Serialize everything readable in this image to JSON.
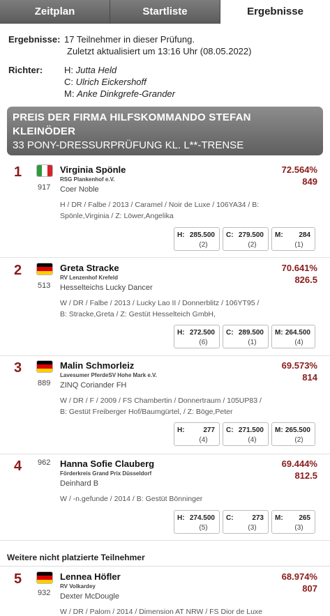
{
  "tabs": [
    {
      "label": "Zeitplan"
    },
    {
      "label": "Startliste"
    },
    {
      "label": "Ergebnisse"
    }
  ],
  "info": {
    "results_label": "Ergebnisse:",
    "results_line1": "17 Teilnehmer in dieser Prüfung.",
    "results_line2": "Zuletzt aktualisiert um 13:16 Uhr (08.05.2022)",
    "judges_label": "Richter:",
    "judges": [
      {
        "pos": "H:",
        "name": "Jutta Held"
      },
      {
        "pos": "C:",
        "name": "Ulrich Eickershoff"
      },
      {
        "pos": "M:",
        "name": "Anke Dinkgrefe-Grander"
      }
    ]
  },
  "competition": {
    "title_line1": "PREIS DER FIRMA HILFSKOMMANDO STEFAN",
    "title_line2": "KLEINÖDER",
    "subtitle": "33 PONY-DRESSURPRÜFUNG KL. L**-TRENSE"
  },
  "colors": {
    "accent": "#8b1a1a",
    "banner": "#6e6e6e"
  },
  "results": [
    {
      "rank": "1",
      "flag": "italy-flag",
      "bib": "917",
      "rider": "Virginia Spönle",
      "club": "RSG Plankenhof e.V.",
      "horse": "Coer Noble",
      "details_line1": "H / DR / Falbe / 2013 / Caramel / Noir de Luxe / 106YA34 / B:",
      "details_line2": "Spönle,Virginia / Z: Löwer,Angelika",
      "percent": "72.564%",
      "points": "849",
      "scores": [
        {
          "judge": "H:",
          "score": "285.500",
          "rank": "(2)"
        },
        {
          "judge": "C:",
          "score": "279.500",
          "rank": "(2)"
        },
        {
          "judge": "M:",
          "score": "284",
          "rank": "(1)"
        }
      ]
    },
    {
      "rank": "2",
      "flag": "germany-flag",
      "bib": "513",
      "rider": "Greta Stracke",
      "club": "RV Lenzenhof Krefeld",
      "horse": "Hesselteichs Lucky Dancer",
      "details_line1": "W / DR / Falbe / 2013 / Lucky Lao II / Donnerblitz / 106YT95 /",
      "details_line2": "B: Stracke,Greta / Z: Gestüt Hesselteich GmbH,",
      "percent": "70.641%",
      "points": "826.5",
      "scores": [
        {
          "judge": "H:",
          "score": "272.500",
          "rank": "(6)"
        },
        {
          "judge": "C:",
          "score": "289.500",
          "rank": "(1)"
        },
        {
          "judge": "M:",
          "score": "264.500",
          "rank": "(4)"
        }
      ]
    },
    {
      "rank": "3",
      "flag": "germany-flag",
      "bib": "889",
      "rider": "Malin Schmorleiz",
      "club": "Lavesumer PferdeSV Hohe Mark e.V.",
      "horse": "ZINQ Coriander FH",
      "details_line1": "W / DR / F / 2009 / FS Chambertin / Donnertraum / 105UP83 /",
      "details_line2": "B: Gestüt Freiberger Hof/Baumgürtel, / Z: Böge,Peter",
      "percent": "69.573%",
      "points": "814",
      "scores": [
        {
          "judge": "H:",
          "score": "277",
          "rank": "(4)"
        },
        {
          "judge": "C:",
          "score": "271.500",
          "rank": "(4)"
        },
        {
          "judge": "M:",
          "score": "265.500",
          "rank": "(2)"
        }
      ]
    },
    {
      "rank": "4",
      "flag": "",
      "bib": "962",
      "rider": "Hanna Sofie Clauberg",
      "club": "Förderkreis Grand Prix Düsseldorf",
      "horse": "Deinhard B",
      "details_line1": "W / -n.gefunde / 2014 / B: Gestüt Bönninger",
      "details_line2": "",
      "percent": "69.444%",
      "points": "812.5",
      "scores": [
        {
          "judge": "H:",
          "score": "274.500",
          "rank": "(5)"
        },
        {
          "judge": "C:",
          "score": "273",
          "rank": "(3)"
        },
        {
          "judge": "M:",
          "score": "265",
          "rank": "(3)"
        }
      ]
    }
  ],
  "unplaced_heading": "Weitere nicht platzierte Teilnehmer",
  "unplaced": [
    {
      "rank": "5",
      "flag": "germany-flag",
      "bib": "932",
      "rider": "Lennea Höfler",
      "club": "RV Volkardey",
      "horse": "Dexter McDougle",
      "details_line1": "W / DR / Palom / 2014 / Dimension AT NRW / FS Dior de Luxe",
      "percent": "68.974%",
      "points": "807"
    }
  ]
}
